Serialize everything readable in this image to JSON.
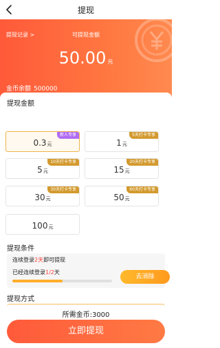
{
  "header": {
    "title": "提现"
  },
  "banner": {
    "record_label": "提现记录 >",
    "available_label": "可提现金额",
    "amount": "50.00",
    "amount_unit": "元",
    "coins_label": "金币余额",
    "coins_value": "500000"
  },
  "amount_section": {
    "title": "提现金额",
    "options": [
      {
        "value": "0.3",
        "unit": "元",
        "tag": "新人专享",
        "selected": true
      },
      {
        "value": "1",
        "unit": "元",
        "tag": "5天打卡专享"
      },
      {
        "value": "5",
        "unit": "元",
        "tag": "10天打卡专享"
      },
      {
        "value": "15",
        "unit": "元",
        "tag": "20天打卡专享"
      },
      {
        "value": "30",
        "unit": "元",
        "tag": "30天打卡专享"
      },
      {
        "value": "50",
        "unit": "元",
        "tag": "60天打卡专享"
      },
      {
        "value": "100",
        "unit": "元",
        "tag": ""
      }
    ]
  },
  "condition": {
    "title": "提现条件",
    "line1_pre": "连续登录",
    "line1_days": "2天",
    "line1_post": "即可提现",
    "line2_pre": "已经连续登录",
    "line2_progress": "1/2",
    "line2_post": "天",
    "progress_fraction": 0.5,
    "button_label": "去消除"
  },
  "method": {
    "title": "提现方式"
  },
  "footer": {
    "need_label": "所需金币:",
    "need_value": "3000",
    "button_label": "立即提现"
  },
  "colors": {
    "accent": "#ff5a3a",
    "gold": "#d39a2e",
    "purple_tag": "#b06bf2",
    "progress": "#ffae2b"
  }
}
